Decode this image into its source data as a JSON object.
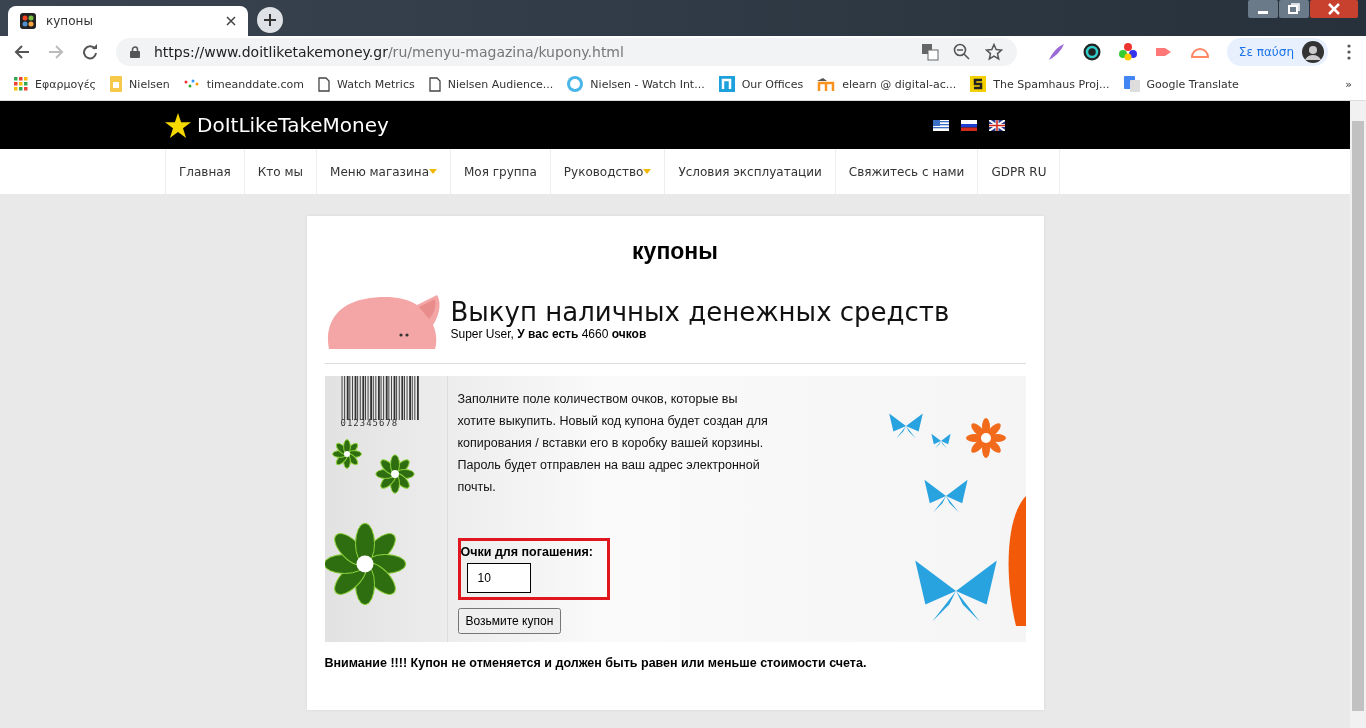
{
  "browser": {
    "tab": {
      "title": "купоны",
      "selected": true
    },
    "url": {
      "host": "https://www.doitliketakemoney.gr",
      "path": "/ru/menyu-magazina/kupony.html"
    },
    "profile": {
      "label": "Σε παύση"
    },
    "bookmarks": [
      {
        "label": "Εφαρμογές",
        "kind": "apps"
      },
      {
        "label": "Nielsen",
        "kind": "folder"
      },
      {
        "label": "timeanddate.com",
        "kind": "dots"
      },
      {
        "label": "Watch Metrics",
        "kind": "page"
      },
      {
        "label": "Nielsen Audience...",
        "kind": "page"
      },
      {
        "label": "Nielsen - Watch Int...",
        "kind": "circle"
      },
      {
        "label": "Our Offices",
        "kind": "n"
      },
      {
        "label": "elearn @ digital-ac...",
        "kind": "m"
      },
      {
        "label": "The Spamhaus Proj...",
        "kind": "s"
      },
      {
        "label": "Google Translate",
        "kind": "translate"
      }
    ],
    "more": "»"
  },
  "site": {
    "logo": "DoItLikeTakeMoney",
    "nav": [
      {
        "label": "Главная",
        "dropdown": false
      },
      {
        "label": "Кто мы",
        "dropdown": false
      },
      {
        "label": "Меню магазина",
        "dropdown": true
      },
      {
        "label": "Моя группа",
        "dropdown": false
      },
      {
        "label": "Руководство",
        "dropdown": true
      },
      {
        "label": "Условия эксплуатации",
        "dropdown": false
      },
      {
        "label": "Свяжитесь с нами",
        "dropdown": false
      },
      {
        "label": "GDPR RU",
        "dropdown": false
      }
    ]
  },
  "page": {
    "title": "купоны",
    "heading": "Выкуп наличных денежных средств",
    "user_line": "Super User, **У вас есть** 4660 **очков**",
    "barcode_digits": "012345678",
    "instructions": "Заполните поле количеством очков, которые вы хотите выкупить. Новый код купона будет создан для копирования / вставки его в коробку вашей корзины. Пароль будет отправлен на ваш адрес электронной почты.",
    "points_label": "Очки для погашения:",
    "points_value": "10",
    "submit": "Возьмите купон",
    "warning": "Внимание !!!! Купон не отменяется и должен быть равен или меньше стоимости счета."
  }
}
